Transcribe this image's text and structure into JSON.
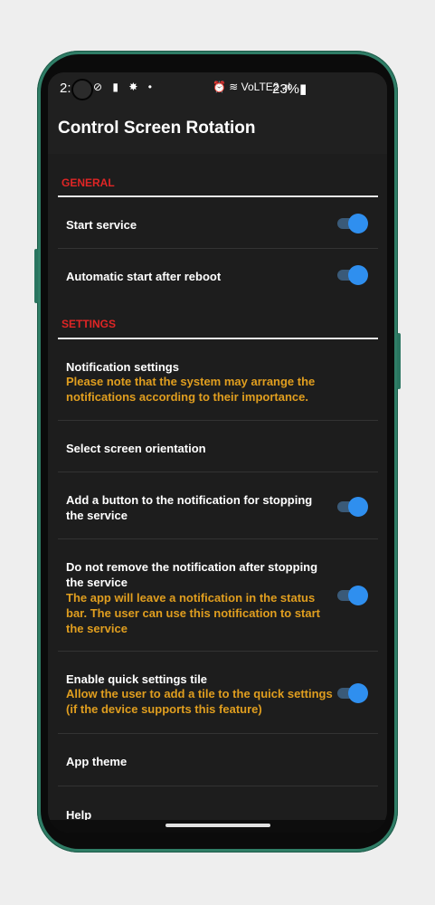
{
  "statusbar": {
    "time": "2:",
    "left_icons": "⊘ ▮ ✸ •",
    "network": "⏰ ≋ VoLTE2 .ıl",
    "battery": "23%▮"
  },
  "app": {
    "title": "Control Screen Rotation"
  },
  "sections": {
    "general": "GENERAL",
    "settings": "SETTINGS"
  },
  "rows": {
    "start_service": {
      "title": "Start service",
      "checked": true
    },
    "auto_start": {
      "title": "Automatic start after reboot",
      "checked": true
    },
    "notification_settings": {
      "title": "Notification settings",
      "subtitle": "Please note that the system may arrange the notifications according to their importance."
    },
    "select_orientation": {
      "title": "Select screen orientation"
    },
    "add_button": {
      "title": "Add a button to the notification for stopping the service",
      "checked": true
    },
    "do_not_remove": {
      "title": "Do not remove the notification after stopping the service",
      "subtitle": "The app will leave a notification in the status bar. The user can use this notification to start the service",
      "checked": true
    },
    "quick_tile": {
      "title": "Enable quick settings tile",
      "subtitle": "Allow the user to add a tile to the quick settings (if the device supports this feature)",
      "checked": true
    },
    "app_theme": {
      "title": "App theme"
    },
    "help": {
      "title": "Help"
    }
  },
  "colors": {
    "accent": "#2f8fef",
    "section_header": "#e02525",
    "subtitle": "#e09e1f",
    "background": "#1d1d1d",
    "frame": "#2f7d66"
  },
  "icons": [
    "camera-icon",
    "dnd-icon",
    "clipboard-icon",
    "brightness-icon",
    "alarm-icon",
    "wifi-icon",
    "signal-icon",
    "battery-icon"
  ]
}
